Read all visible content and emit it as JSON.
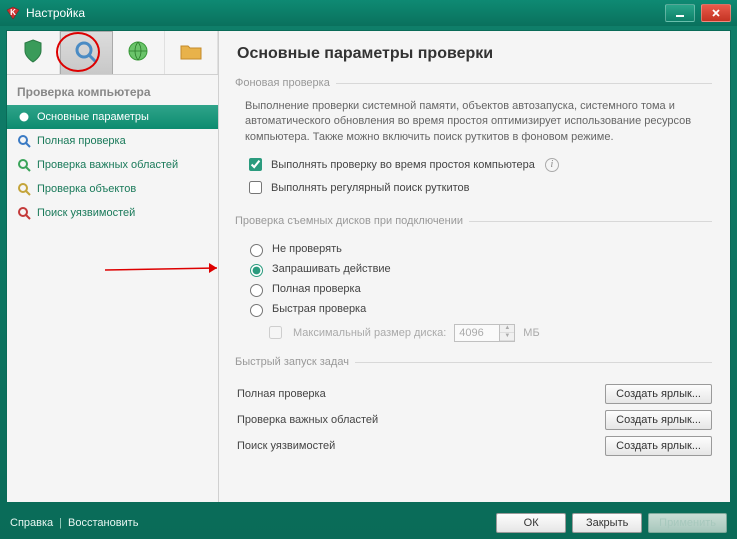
{
  "window": {
    "title": "Настройка"
  },
  "tabs": [
    {
      "name": "protection-tab",
      "icon": "shield-icon"
    },
    {
      "name": "scan-tab",
      "icon": "magnifier-icon",
      "active": true
    },
    {
      "name": "update-tab",
      "icon": "globe-icon"
    },
    {
      "name": "misc-tab",
      "icon": "folder-icon"
    }
  ],
  "sidebar": {
    "section": "Проверка компьютера",
    "items": [
      {
        "icon": "dot-icon",
        "label": "Основные параметры",
        "active": true
      },
      {
        "icon": "magnifier-blue-icon",
        "label": "Полная проверка"
      },
      {
        "icon": "magnifier-green-icon",
        "label": "Проверка важных областей"
      },
      {
        "icon": "magnifier-yellow-icon",
        "label": "Проверка объектов"
      },
      {
        "icon": "magnifier-red-icon",
        "label": "Поиск уязвимостей"
      }
    ]
  },
  "content": {
    "heading": "Основные параметры проверки",
    "group_bg": {
      "legend": "Фоновая проверка",
      "desc": "Выполнение проверки системной памяти, объектов автозапуска, системного тома и автоматического обновления во время простоя оптимизирует использование ресурсов компьютера. Также можно включить поиск руткитов в фоновом режиме.",
      "chk_idle": {
        "label": "Выполнять проверку во время простоя компьютера",
        "checked": true
      },
      "chk_rootkit": {
        "label": "Выполнять регулярный поиск руткитов",
        "checked": false
      }
    },
    "group_removable": {
      "legend": "Проверка съемных дисков при подключении",
      "radios": {
        "selected": "ask",
        "no_scan": "Не проверять",
        "ask": "Запрашивать действие",
        "full": "Полная проверка",
        "quick": "Быстрая проверка"
      },
      "max_size": {
        "label": "Максимальный размер диска:",
        "value": "4096",
        "unit": "МБ",
        "enabled": false
      }
    },
    "group_tasks": {
      "legend": "Быстрый запуск задач",
      "rows": [
        {
          "label": "Полная проверка",
          "button": "Создать ярлык..."
        },
        {
          "label": "Проверка важных областей",
          "button": "Создать ярлык..."
        },
        {
          "label": "Поиск уязвимостей",
          "button": "Создать ярлык..."
        }
      ]
    }
  },
  "footer": {
    "help": "Справка",
    "restore": "Восстановить",
    "ok": "ОК",
    "close": "Закрыть",
    "apply": "Применить"
  }
}
